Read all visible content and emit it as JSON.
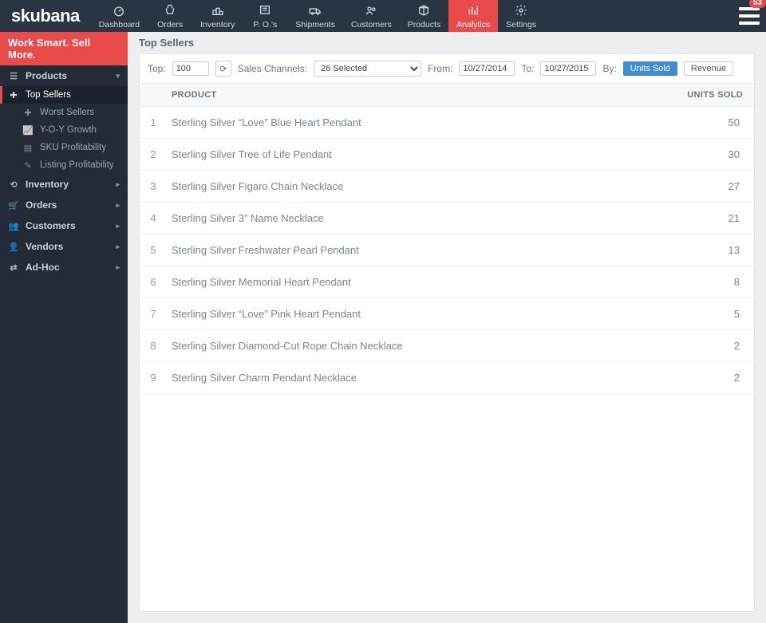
{
  "brand": "skubana",
  "nav": {
    "items": [
      {
        "id": "dashboard",
        "label": "Dashboard"
      },
      {
        "id": "orders",
        "label": "Orders"
      },
      {
        "id": "inventory",
        "label": "Inventory"
      },
      {
        "id": "pos",
        "label": "P. O.'s"
      },
      {
        "id": "shipments",
        "label": "Shipments"
      },
      {
        "id": "customers",
        "label": "Customers"
      },
      {
        "id": "products",
        "label": "Products"
      },
      {
        "id": "analytics",
        "label": "Analytics"
      },
      {
        "id": "settings",
        "label": "Settings"
      }
    ],
    "active": "analytics",
    "notif_count": "53"
  },
  "sidebar": {
    "tagline": "Work Smart. Sell More.",
    "products_section": "Products",
    "subs": [
      {
        "id": "top",
        "label": "Top Sellers"
      },
      {
        "id": "worst",
        "label": "Worst Sellers"
      },
      {
        "id": "yoy",
        "label": "Y-O-Y Growth"
      },
      {
        "id": "sku",
        "label": "SKU Profitability"
      },
      {
        "id": "listing",
        "label": "Listing Profitability"
      }
    ],
    "active_sub": "top",
    "sections": [
      {
        "id": "inventory",
        "label": "Inventory"
      },
      {
        "id": "orders",
        "label": "Orders"
      },
      {
        "id": "customers",
        "label": "Customers"
      },
      {
        "id": "vendors",
        "label": "Vendors"
      },
      {
        "id": "adhoc",
        "label": "Ad-Hoc"
      }
    ]
  },
  "page_title": "Top Sellers",
  "filters": {
    "top_label": "Top:",
    "top_value": "100",
    "sales_label": "Sales Channels:",
    "sales_value": "26 Selected",
    "from_label": "From:",
    "from_value": "10/27/2014",
    "to_label": "To:",
    "to_value": "10/27/2015",
    "by_label": "By:",
    "by_units": "Units Sold",
    "by_revenue": "Revenue",
    "by_active": "units"
  },
  "table": {
    "col_product": "PRODUCT",
    "col_units": "UNITS SOLD",
    "rows": [
      {
        "rank": "1",
        "product": "Sterling Silver “Love” Blue Heart Pendant",
        "units": "50"
      },
      {
        "rank": "2",
        "product": "Sterling Silver Tree of Life Pendant",
        "units": "30"
      },
      {
        "rank": "3",
        "product": "Sterling Silver Figaro Chain Necklace",
        "units": "27"
      },
      {
        "rank": "4",
        "product": "Sterling Silver 3” Name Necklace",
        "units": "21"
      },
      {
        "rank": "5",
        "product": "Sterling Silver Freshwater Pearl Pendant",
        "units": "13"
      },
      {
        "rank": "6",
        "product": "Sterling Silver Memorial Heart Pendant",
        "units": "8"
      },
      {
        "rank": "7",
        "product": "Sterling Silver “Love” Pink Heart Pendant",
        "units": "5"
      },
      {
        "rank": "8",
        "product": "Sterling Silver Diamond-Cut Rope Chain Necklace",
        "units": "2"
      },
      {
        "rank": "9",
        "product": "Sterling Silver Charm Pendant Necklace",
        "units": "2"
      }
    ]
  }
}
